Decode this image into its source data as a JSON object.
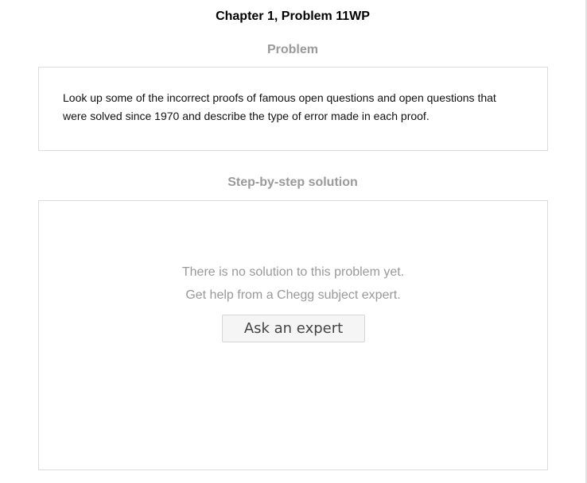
{
  "header": {
    "chapter_title": "Chapter 1, Problem 11WP"
  },
  "problem": {
    "heading": "Problem",
    "text": "Look up some of the incorrect proofs of famous open questions and open questions that were solved since 1970 and describe the type of error made in each proof."
  },
  "solution": {
    "heading": "Step-by-step solution",
    "message_line1": "There is no solution to this problem yet.",
    "message_line2": "Get help from a Chegg subject expert.",
    "ask_button_label": "Ask an expert"
  },
  "colors": {
    "heading_gray": "#9a9a9a",
    "message_gray": "#999999",
    "card_border": "#dcdcdc",
    "button_bg": "#f5f5f5"
  }
}
